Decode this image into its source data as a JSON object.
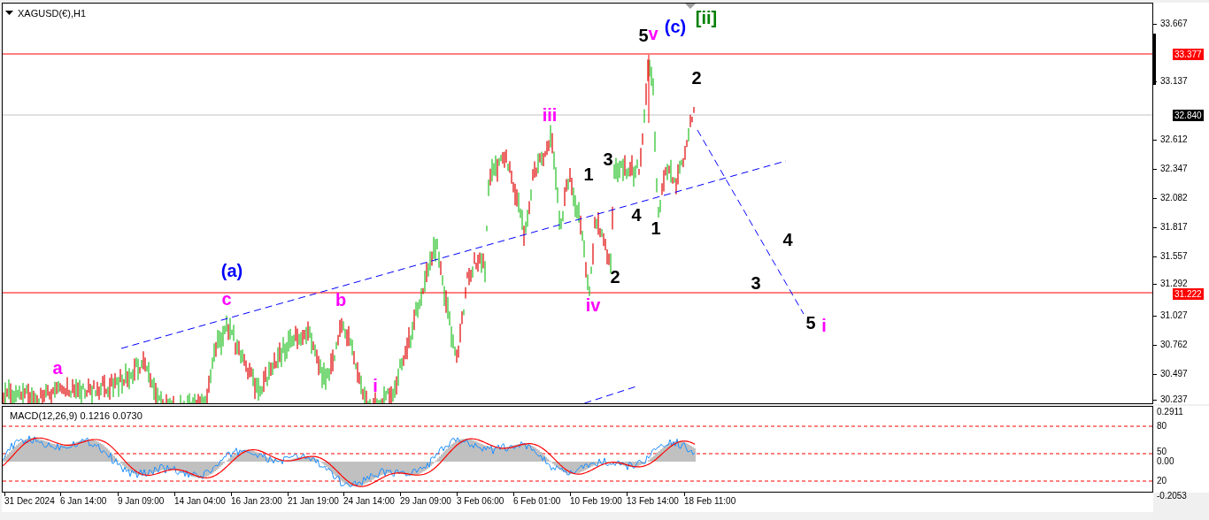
{
  "chart": {
    "title": "XAGUSD(€),H1",
    "wave_labels": [
      {
        "text": "5",
        "color": "#000000"
      },
      {
        "text": "v",
        "color": "#ff00ff"
      },
      {
        "text": "(c)",
        "color": "#0000ff"
      },
      {
        "text": "[ii]",
        "color": "#008000"
      },
      {
        "text": "2",
        "color": "#000000"
      },
      {
        "text": "iii",
        "color": "#ff00ff"
      },
      {
        "text": "3",
        "color": "#000000"
      },
      {
        "text": "1",
        "color": "#000000"
      },
      {
        "text": "4",
        "color": "#000000"
      },
      {
        "text": "1",
        "color": "#000000"
      },
      {
        "text": "4",
        "color": "#000000"
      },
      {
        "text": "(a)",
        "color": "#0000ff"
      },
      {
        "text": "2",
        "color": "#000000"
      },
      {
        "text": "3",
        "color": "#000000"
      },
      {
        "text": "c",
        "color": "#ff00ff"
      },
      {
        "text": "b",
        "color": "#ff00ff"
      },
      {
        "text": "iv",
        "color": "#ff00ff"
      },
      {
        "text": "5",
        "color": "#000000"
      },
      {
        "text": "i",
        "color": "#ff00ff"
      },
      {
        "text": "a",
        "color": "#ff00ff"
      },
      {
        "text": "i",
        "color": "#ff00ff"
      }
    ],
    "price_axis": [
      {
        "label": "33.667",
        "kind": "tick"
      },
      {
        "label": "33.377",
        "kind": "tag",
        "color": "#ff0000"
      },
      {
        "label": "33.137",
        "kind": "tick"
      },
      {
        "label": "32.840",
        "kind": "tag",
        "color": "#000000"
      },
      {
        "label": "32.612",
        "kind": "tick"
      },
      {
        "label": "32.347",
        "kind": "tick"
      },
      {
        "label": "32.082",
        "kind": "tick"
      },
      {
        "label": "31.817",
        "kind": "tick"
      },
      {
        "label": "31.557",
        "kind": "tick"
      },
      {
        "label": "31.292",
        "kind": "tick"
      },
      {
        "label": "31.222",
        "kind": "tag",
        "color": "#ff0000"
      },
      {
        "label": "31.027",
        "kind": "tick"
      },
      {
        "label": "30.762",
        "kind": "tick"
      },
      {
        "label": "30.497",
        "kind": "tick"
      },
      {
        "label": "30.237",
        "kind": "tick"
      }
    ]
  },
  "macd": {
    "title": "MACD(12,26,9) 0.1216 0.0730",
    "axis": [
      "0.2911",
      "80",
      "50",
      "0.00",
      "20",
      "-0.2053"
    ]
  },
  "time_axis": [
    "31 Dec 2024",
    "6 Jan 14:00",
    "9 Jan 09:00",
    "14 Jan 04:00",
    "16 Jan 23:00",
    "21 Jan 19:00",
    "24 Jan 14:00",
    "29 Jan 09:00",
    "3 Feb 06:00",
    "6 Feb 01:00",
    "10 Feb 19:00",
    "13 Feb 14:00",
    "18 Feb 11:00"
  ]
}
